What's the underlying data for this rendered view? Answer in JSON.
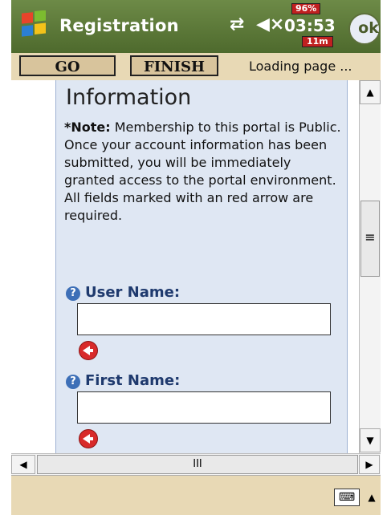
{
  "titlebar": {
    "title": "Registration",
    "connectivity_icon": "arrows-icon",
    "volume_icon": "speaker-mute-icon",
    "clock": "03:53",
    "battery": "96%",
    "memory": "11m",
    "ok_label": "ok"
  },
  "toolbar": {
    "go_label": "GO",
    "finish_label": "FINISH",
    "status": "Loading page ..."
  },
  "content": {
    "heading": "Information",
    "note_bold": "*Note:",
    "note_text": " Membership to this portal is Public. Once your account information has been submitted, you will be immediately granted access to the portal environment. All fields marked with an red arrow are required.",
    "fields": [
      {
        "label": "User Name:",
        "value": ""
      },
      {
        "label": "First Name:",
        "value": ""
      }
    ]
  },
  "scrollbars": {
    "up": "▲",
    "down": "▼",
    "grip": "≡",
    "left": "◀",
    "right": "▶",
    "hgrip": "III"
  },
  "bottombar": {
    "keyboard_icon": "keyboard-icon",
    "keyboard_label": "⌨",
    "arrow": "▲"
  }
}
